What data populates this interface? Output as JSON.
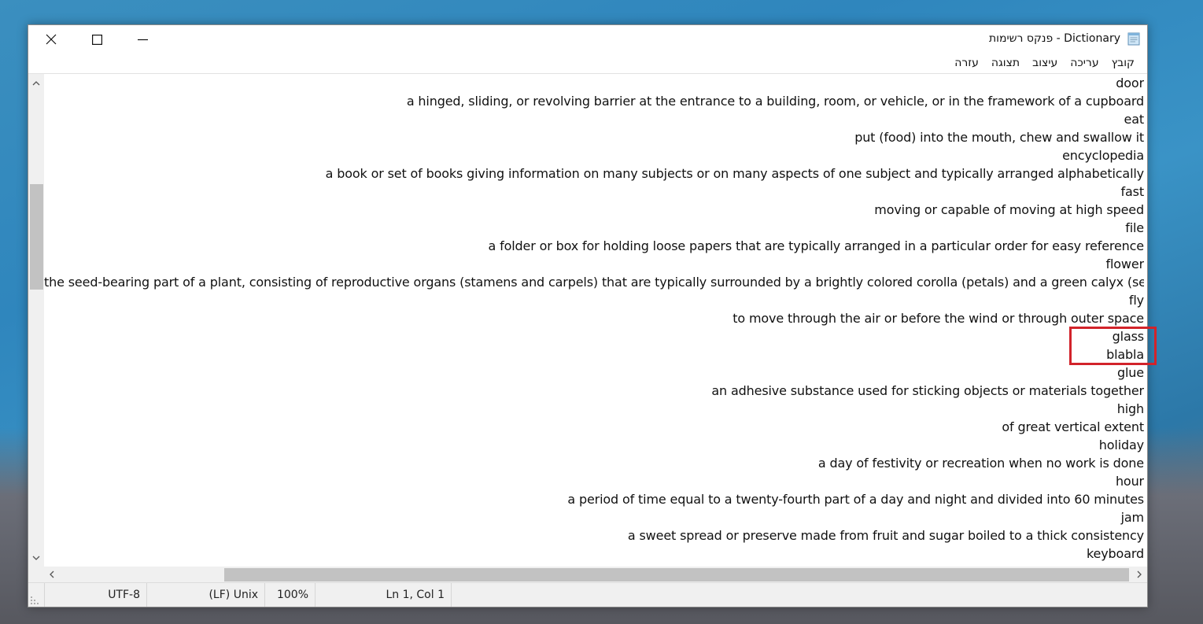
{
  "window": {
    "title": "פנקס רשימות - Dictionary",
    "icon": "notepad-icon"
  },
  "caption_buttons": {
    "close_icon": "close-icon",
    "maximize_icon": "maximize-icon",
    "minimize_icon": "minimize-icon"
  },
  "menu": {
    "items": [
      "קובץ",
      "עריכה",
      "עיצוב",
      "תצוגה",
      "עזרה"
    ]
  },
  "content": {
    "lines": [
      "door",
      "a hinged, sliding, or revolving barrier at the entrance to a building, room, or vehicle, or in the framework of a cupboard",
      "eat",
      "put (food) into the mouth, chew and swallow it",
      "encyclopedia",
      "a book or set of books giving information on many subjects or on many aspects of one subject and typically arranged alphabetically",
      "fast",
      "moving or capable of moving at high speed",
      "file",
      "a folder or box for holding loose papers that are typically arranged in a particular order for easy reference",
      "flower",
      "the seed-bearing part of a plant, consisting of reproductive organs (stamens and carpels) that are typically surrounded by a brightly colored corolla (petals) and a green calyx (sepals)",
      "fly",
      "to move through the air or before the wind or through outer space",
      "glass",
      "blabla",
      "glue",
      "an adhesive substance used for sticking objects or materials together",
      "high",
      "of great vertical extent",
      "holiday",
      "a day of festivity or recreation when no work is done",
      "hour",
      "a period of time equal to a twenty-fourth part of a day and night and divided into 60 minutes",
      "jam",
      "a sweet spread or preserve made from fruit and sugar boiled to a thick consistency",
      "keyboard"
    ],
    "highlight_color": "#d2232a"
  },
  "status": {
    "encoding": "UTF-8",
    "line_endings": "(LF) Unix",
    "zoom": "100%",
    "position": "Ln 1, Col 1"
  }
}
